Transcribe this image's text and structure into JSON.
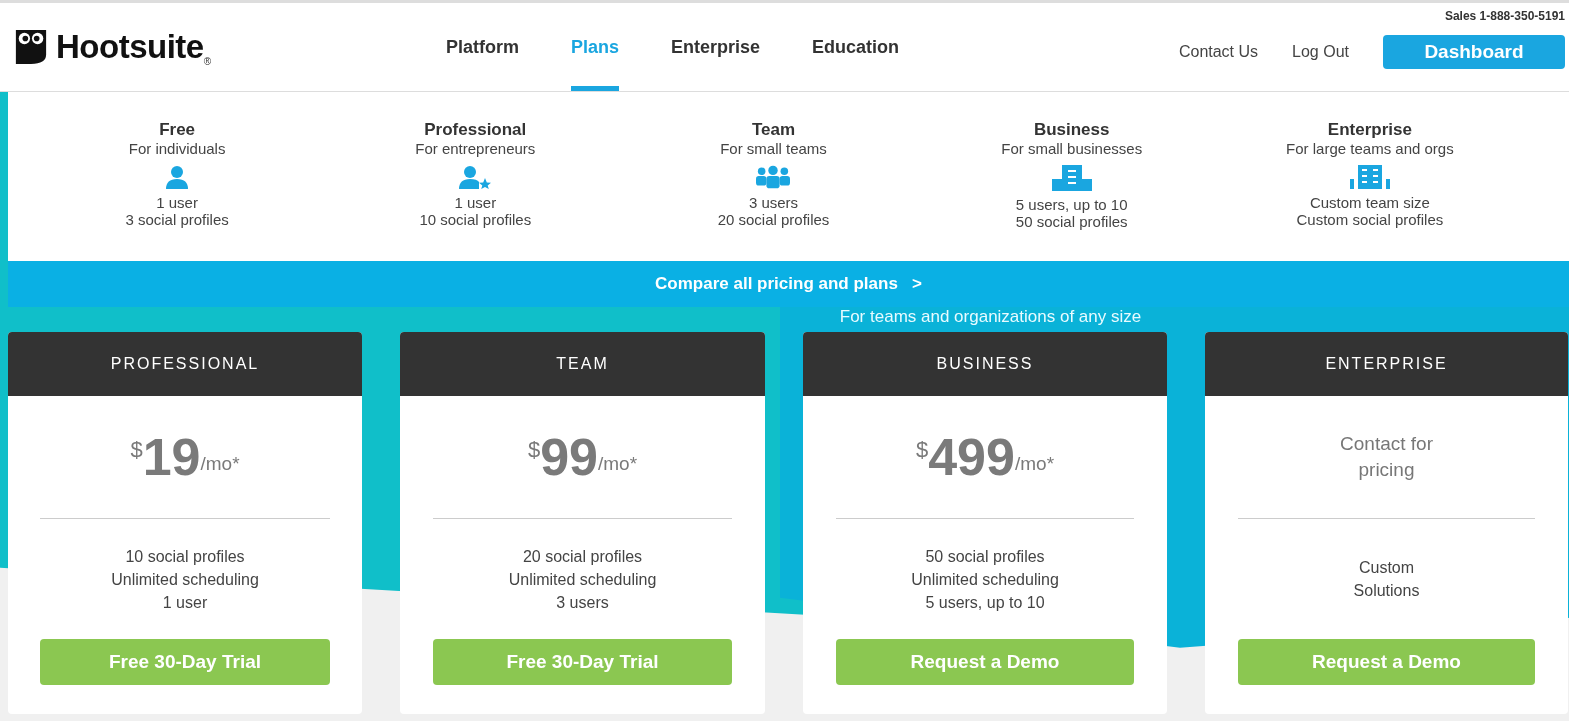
{
  "header": {
    "logo": "Hootsuite",
    "logo_mark": "®",
    "sales": "Sales 1-888-350-5191",
    "nav": [
      {
        "label": "Platform",
        "selected": false
      },
      {
        "label": "Plans",
        "selected": true
      },
      {
        "label": "Enterprise",
        "selected": false
      },
      {
        "label": "Education",
        "selected": false
      }
    ],
    "links": [
      "Contact Us",
      "Log Out"
    ],
    "dashboard_button": "Dashboard"
  },
  "tiers": [
    {
      "name": "Free",
      "subtitle": "For individuals",
      "kind": "user",
      "users": "1 user",
      "profiles": "3 social profiles"
    },
    {
      "name": "Professional",
      "subtitle": "For entrepreneurs",
      "kind": "user-star",
      "users": "1 user",
      "profiles": "10 social profiles"
    },
    {
      "name": "Team",
      "subtitle": "For small teams",
      "kind": "group",
      "users": "3 users",
      "profiles": "20 social profiles"
    },
    {
      "name": "Business",
      "subtitle": "For small businesses",
      "kind": "building",
      "users": "5 users, up to 10",
      "profiles": "50 social profiles"
    },
    {
      "name": "Enterprise",
      "subtitle": "For large teams and orgs",
      "kind": "buildings",
      "users": "Custom team size",
      "profiles": "Custom social profiles"
    }
  ],
  "compare_link": "Compare all pricing and plans",
  "compare_arrow": ">",
  "teams_note": "For teams and organizations of any size",
  "cards": [
    {
      "title": "PROFESSIONAL",
      "kind": "price",
      "currency": "$",
      "amount": "19",
      "unit": "/mo*",
      "features": [
        "10 social profiles",
        "Unlimited scheduling",
        "1 user"
      ],
      "button": "Free 30-Day Trial"
    },
    {
      "title": "TEAM",
      "kind": "price",
      "currency": "$",
      "amount": "99",
      "unit": "/mo*",
      "features": [
        "20 social profiles",
        "Unlimited scheduling",
        "3 users"
      ],
      "button": "Free 30-Day Trial"
    },
    {
      "title": "BUSINESS",
      "kind": "price",
      "currency": "$",
      "amount": "499",
      "unit": "/mo*",
      "features": [
        "50 social profiles",
        "Unlimited scheduling",
        "5 users, up to 10"
      ],
      "button": "Request a Demo"
    },
    {
      "title": "ENTERPRISE",
      "kind": "contact",
      "contact_lines": [
        "Contact for",
        "pricing"
      ],
      "features": [
        "Custom",
        "Solutions"
      ],
      "button": "Request a Demo"
    }
  ]
}
